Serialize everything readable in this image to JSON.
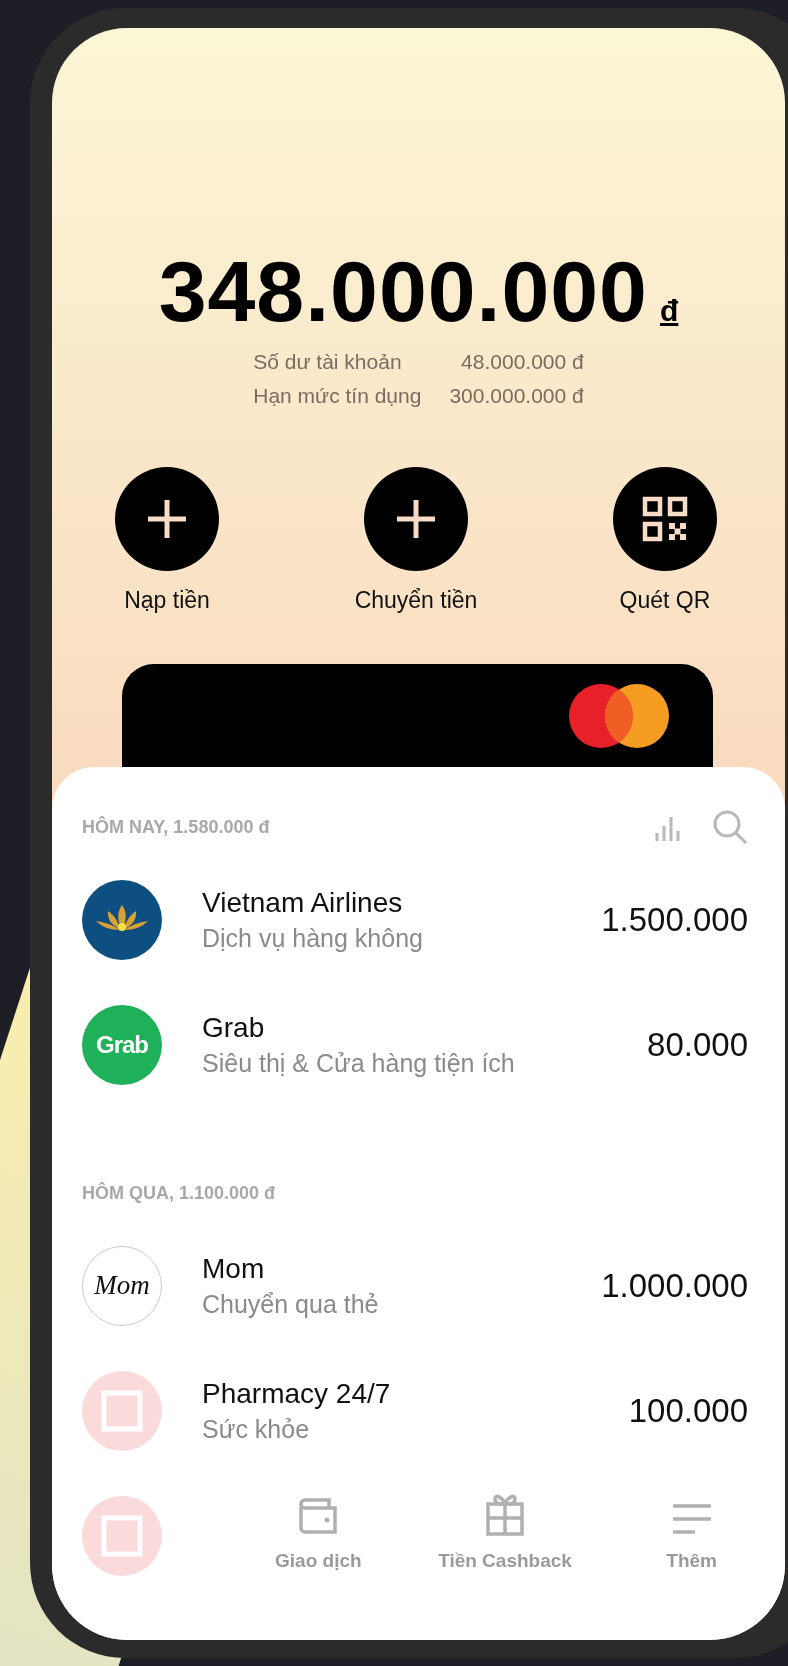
{
  "balance": {
    "amount": "348.000.000",
    "currency": "đ",
    "details": [
      {
        "label": "Số dư tài khoản",
        "value": "48.000.000 đ"
      },
      {
        "label": "Hạn mức tín dụng",
        "value": "300.000.000 đ"
      }
    ]
  },
  "actions": [
    {
      "kind": "plus",
      "label": "Nạp tiền"
    },
    {
      "kind": "plus",
      "label": "Chuyển tiền"
    },
    {
      "kind": "qr",
      "label": "Quét QR"
    }
  ],
  "sections": [
    {
      "heading": "HÔM NAY, 1.580.000 đ",
      "show_tools": true,
      "transactions": [
        {
          "kind": "airline",
          "title": "Vietnam Airlines",
          "subtitle": "Dịch vụ hàng không",
          "amount": "1.500.000"
        },
        {
          "kind": "grab",
          "logo_text": "Grab",
          "title": "Grab",
          "subtitle": "Siêu thị & Cửa hàng tiện ích",
          "amount": "80.000"
        }
      ]
    },
    {
      "heading": "HÔM QUA, 1.100.000 đ",
      "show_tools": false,
      "transactions": [
        {
          "kind": "script",
          "logo_text": "Mom",
          "title": "Mom",
          "subtitle": "Chuyển qua thẻ",
          "amount": "1.000.000"
        },
        {
          "kind": "placeholder",
          "title": "Pharmacy 24/7",
          "subtitle": "Sức khỏe",
          "amount": "100.000"
        },
        {
          "kind": "placeholder"
        }
      ]
    }
  ],
  "tabs": [
    {
      "kind": "wallet",
      "label": "Giao dịch"
    },
    {
      "kind": "gift",
      "label": "Tiền Cashback"
    },
    {
      "kind": "menu",
      "label": "Thêm"
    }
  ]
}
